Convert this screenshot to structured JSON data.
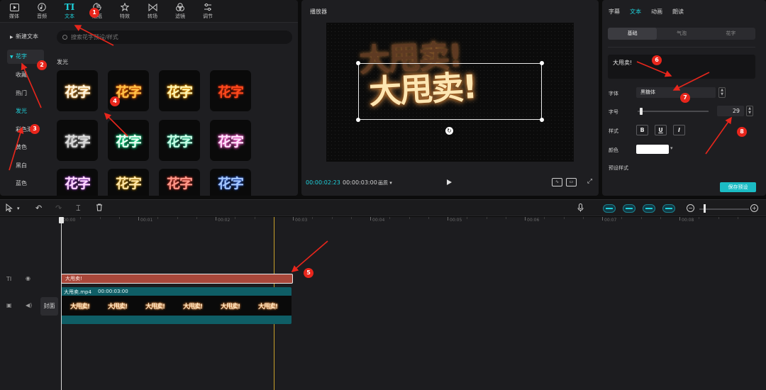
{
  "toolbar": {
    "tools": [
      {
        "label": "媒体",
        "icon": "media-icon"
      },
      {
        "label": "音频",
        "icon": "audio-icon"
      },
      {
        "label": "文本",
        "icon": "text-icon"
      },
      {
        "label": "贴纸",
        "icon": "sticker-icon"
      },
      {
        "label": "特效",
        "icon": "effects-icon"
      },
      {
        "label": "转场",
        "icon": "transition-icon"
      },
      {
        "label": "滤镜",
        "icon": "filter-icon"
      },
      {
        "label": "调节",
        "icon": "adjust-icon"
      }
    ],
    "active_tool": "文本",
    "active_icon_glyph": "TI"
  },
  "sidebar": {
    "new_text": "新建文本",
    "group": "花字",
    "items": [
      "收藏",
      "热门",
      "发光",
      "彩色渐变",
      "黄色",
      "黑白",
      "蓝色"
    ],
    "selected": "发光"
  },
  "library": {
    "search_placeholder": "搜索花字预设/样式",
    "section_title": "发光",
    "tile_text": "花字"
  },
  "player": {
    "title": "播放器",
    "overlay_text": "大甩卖!",
    "current_time": "00:00:02:23",
    "duration": "00:00:03:00",
    "mode": "画质"
  },
  "properties": {
    "tabs": [
      "字幕",
      "文本",
      "动画",
      "朗读"
    ],
    "active_tab": "文本",
    "segments": [
      "基础",
      "气泡",
      "花字"
    ],
    "active_segment": "基础",
    "text_value": "大甩卖!",
    "font_label": "字体",
    "font_value": "黑糖体",
    "size_label": "字号",
    "size_value": "29",
    "style_label": "样式",
    "style_buttons": [
      "B",
      "U",
      "I"
    ],
    "color_label": "颜色",
    "color_value": "#ffffff",
    "preset_label": "预设样式",
    "save_button": "保存预设"
  },
  "timeline": {
    "ruler_labels": [
      "00:00",
      "00:01",
      "00:02",
      "00:03",
      "00:04",
      "00:05",
      "00:06",
      "00:07",
      "00:08"
    ],
    "text_clip_label": "大甩卖!",
    "video_clip_name": "大甩卖.mp4",
    "video_clip_duration": "00:00:03:00",
    "cover_label": "封面",
    "track_text_icon": "TI",
    "frame_text": "大甩卖!"
  },
  "annotations": [
    "1",
    "2",
    "3",
    "4",
    "5",
    "6",
    "7",
    "8"
  ],
  "colors": {
    "accent": "#1ed2dc",
    "annotation": "#e8261c",
    "text_clip": "#a8473a",
    "video_clip": "#0f5e66",
    "marker": "#c7a12a"
  }
}
